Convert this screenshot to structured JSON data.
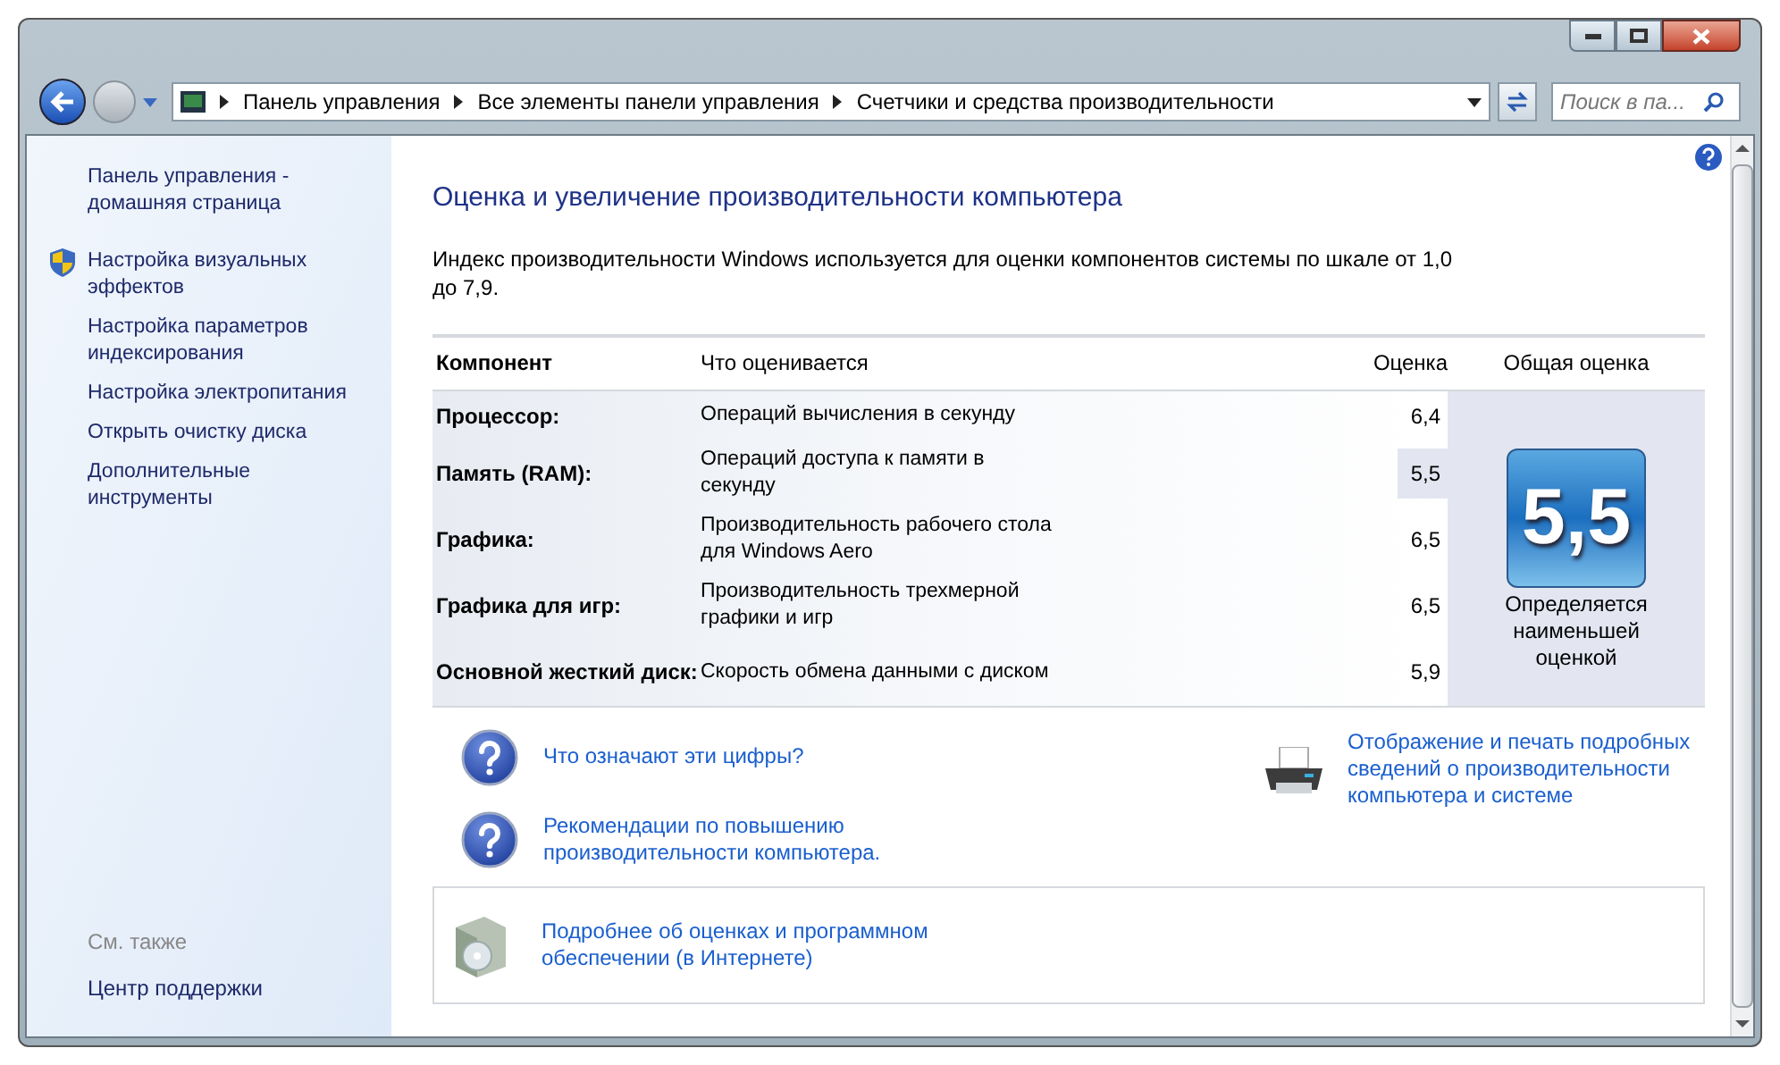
{
  "address_bar": {
    "path": [
      "Панель управления",
      "Все элементы панели управления",
      "Счетчики и средства производительности"
    ],
    "search": {
      "placeholder": "Поиск в па..."
    }
  },
  "sidebar": {
    "items": [
      {
        "label": "Панель управления - домашняя страница",
        "shield": false
      },
      {
        "label": "Настройка визуальных эффектов",
        "shield": true
      },
      {
        "label": "Настройка параметров индексирования",
        "shield": false
      },
      {
        "label": "Настройка электропитания",
        "shield": false
      },
      {
        "label": "Открыть очистку диска",
        "shield": false
      },
      {
        "label": "Дополнительные инструменты",
        "shield": false
      }
    ],
    "see_also": {
      "heading": "См. также",
      "items": [
        "Центр поддержки"
      ]
    }
  },
  "main": {
    "title": "Оценка и увеличение производительности компьютера",
    "description": "Индекс производительности Windows используется для оценки компонентов системы по шкале от 1,0 до 7,9.",
    "table": {
      "columns": [
        "Компонент",
        "Что оценивается",
        "Оценка",
        "Общая оценка"
      ],
      "rows": [
        {
          "component": "Процессор:",
          "measure": "Операций вычисления в секунду",
          "score": "6,4",
          "selected": false
        },
        {
          "component": "Память (RAM):",
          "measure": "Операций доступа к памяти в секунду",
          "score": "5,5",
          "selected": true
        },
        {
          "component": "Графика:",
          "measure": "Производительность рабочего стола для Windows Aero",
          "score": "6,5",
          "selected": false
        },
        {
          "component": "Графика для игр:",
          "measure": "Производительность трехмерной графики и игр",
          "score": "6,5",
          "selected": false
        },
        {
          "component": "Основной жесткий диск:",
          "measure": "Скорость обмена данными с диском",
          "score": "5,9",
          "selected": false
        }
      ],
      "base_score": {
        "value": "5,5",
        "caption": "Определяется наименьшей оценкой"
      }
    },
    "help_links": [
      "Что означают эти цифры?",
      "Рекомендации по повышению производительности компьютера."
    ],
    "print_link": "Отображение и печать подробных сведений о производительности компьютера и системе",
    "online_link": "Подробнее об оценках и программном обеспечении (в Интернете)"
  }
}
